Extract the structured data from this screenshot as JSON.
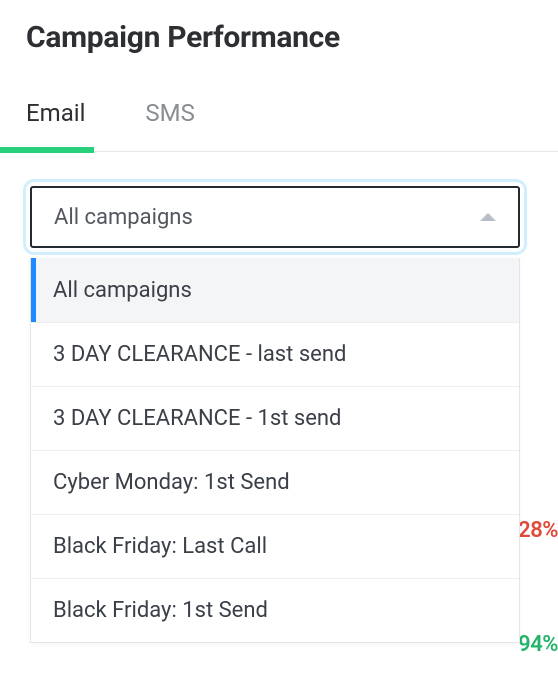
{
  "header": {
    "title": "Campaign Performance"
  },
  "tabs": {
    "items": [
      {
        "label": "Email",
        "active": true
      },
      {
        "label": "SMS",
        "active": false
      }
    ]
  },
  "select": {
    "value": "All campaigns",
    "options": [
      "All campaigns",
      "3 DAY CLEARANCE - last send",
      "3 DAY CLEARANCE - 1st send",
      "Cyber Monday: 1st Send",
      "Black Friday: Last Call",
      "Black Friday: 1st Send"
    ],
    "highlighted_index": 0
  },
  "background_stats": {
    "red": "28%",
    "green": "94%"
  }
}
